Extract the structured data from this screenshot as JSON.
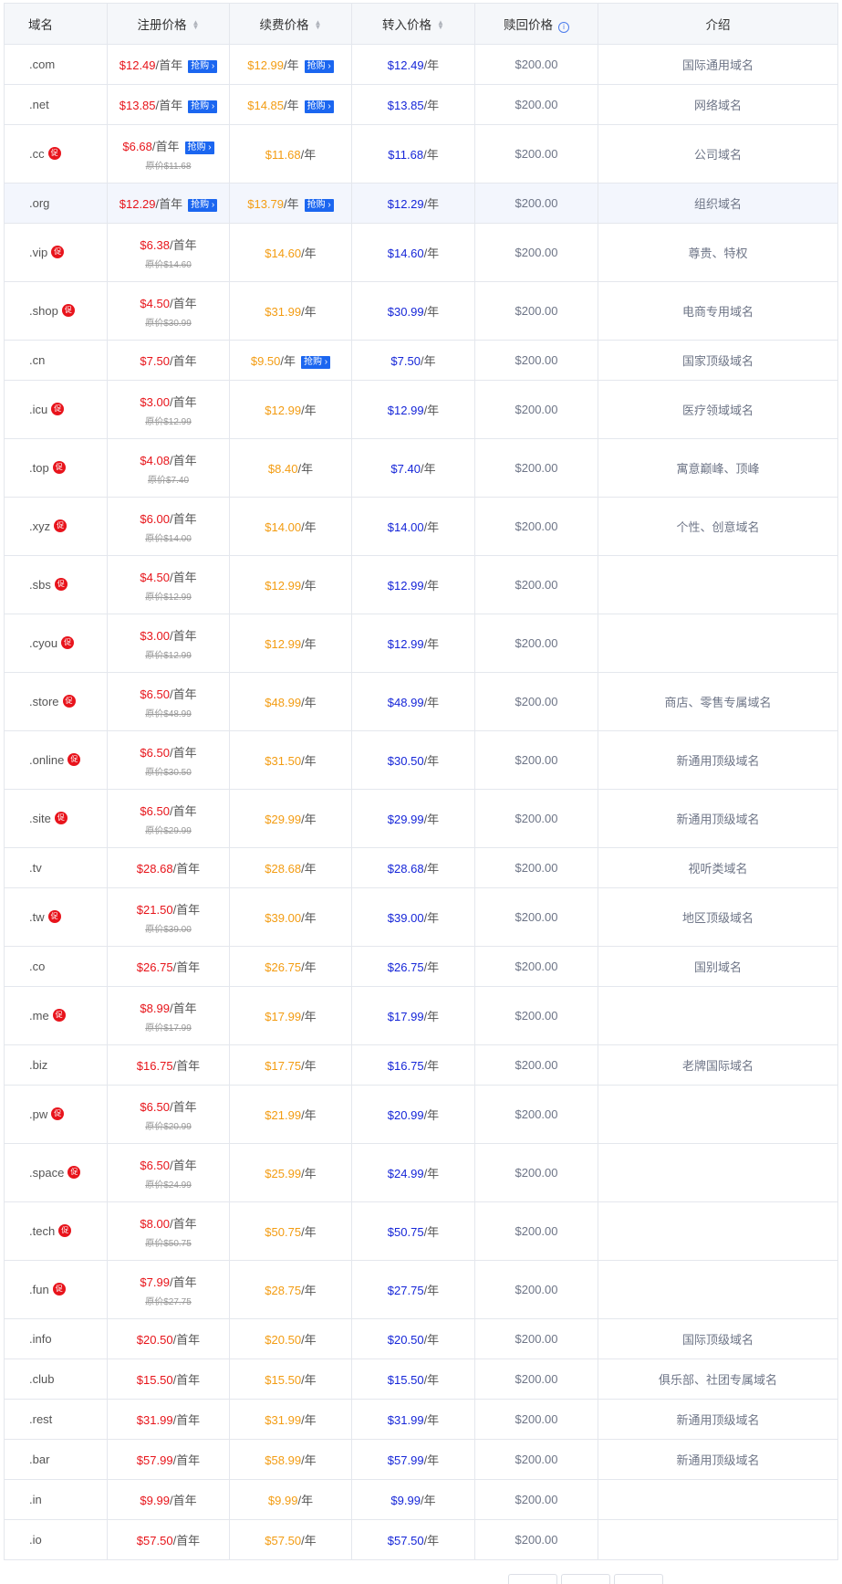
{
  "headers": {
    "domain": "域名",
    "register": "注册价格",
    "renew": "续费价格",
    "transfer": "转入价格",
    "redeem": "赎回价格",
    "intro": "介绍"
  },
  "labels": {
    "first_year": "/首年",
    "per_year": "/年",
    "rush_badge": "抢购",
    "promo_badge": "促"
  },
  "rows": [
    {
      "tld": ".com",
      "promo": false,
      "reg": "$12.49",
      "reg_unit": "/首年",
      "reg_badge": true,
      "orig": "",
      "renew": "$12.99",
      "renew_badge": true,
      "transfer": "$12.49",
      "redeem": "$200.00",
      "intro": "国际通用域名"
    },
    {
      "tld": ".net",
      "promo": false,
      "reg": "$13.85",
      "reg_unit": "/首年",
      "reg_badge": true,
      "orig": "",
      "renew": "$14.85",
      "renew_badge": true,
      "transfer": "$13.85",
      "redeem": "$200.00",
      "intro": "网络域名"
    },
    {
      "tld": ".cc",
      "promo": true,
      "reg": "$6.68",
      "reg_unit": "/首年",
      "reg_badge": true,
      "orig": "原价$11.68",
      "renew": "$11.68",
      "renew_badge": false,
      "transfer": "$11.68",
      "redeem": "$200.00",
      "intro": "公司域名"
    },
    {
      "tld": ".org",
      "promo": false,
      "reg": "$12.29",
      "reg_unit": "/首年",
      "reg_badge": true,
      "orig": "",
      "renew": "$13.79",
      "renew_badge": true,
      "transfer": "$12.29",
      "redeem": "$200.00",
      "intro": "组织域名",
      "highlight": true
    },
    {
      "tld": ".vip",
      "promo": true,
      "reg": "$6.38",
      "reg_unit": "/首年",
      "reg_badge": false,
      "orig": "原价$14.60",
      "renew": "$14.60",
      "renew_badge": false,
      "transfer": "$14.60",
      "redeem": "$200.00",
      "intro": "尊贵、特权"
    },
    {
      "tld": ".shop",
      "promo": true,
      "reg": "$4.50",
      "reg_unit": "/首年",
      "reg_badge": false,
      "orig": "原价$30.99",
      "renew": "$31.99",
      "renew_badge": false,
      "transfer": "$30.99",
      "redeem": "$200.00",
      "intro": "电商专用域名"
    },
    {
      "tld": ".cn",
      "promo": false,
      "reg": "$7.50",
      "reg_unit": "/首年",
      "reg_badge": false,
      "orig": "",
      "renew": "$9.50",
      "renew_badge": true,
      "transfer": "$7.50",
      "redeem": "$200.00",
      "intro": "国家顶级域名"
    },
    {
      "tld": ".icu",
      "promo": true,
      "reg": "$3.00",
      "reg_unit": "/首年",
      "reg_badge": false,
      "orig": "原价$12.99",
      "renew": "$12.99",
      "renew_badge": false,
      "transfer": "$12.99",
      "redeem": "$200.00",
      "intro": "医疗领域域名"
    },
    {
      "tld": ".top",
      "promo": true,
      "reg": "$4.08",
      "reg_unit": "/首年",
      "reg_badge": false,
      "orig": "原价$7.40",
      "renew": "$8.40",
      "renew_badge": false,
      "transfer": "$7.40",
      "redeem": "$200.00",
      "intro": "寓意巅峰、顶峰"
    },
    {
      "tld": ".xyz",
      "promo": true,
      "reg": "$6.00",
      "reg_unit": "/首年",
      "reg_badge": false,
      "orig": "原价$14.00",
      "renew": "$14.00",
      "renew_badge": false,
      "transfer": "$14.00",
      "redeem": "$200.00",
      "intro": "个性、创意域名"
    },
    {
      "tld": ".sbs",
      "promo": true,
      "reg": "$4.50",
      "reg_unit": "/首年",
      "reg_badge": false,
      "orig": "原价$12.99",
      "renew": "$12.99",
      "renew_badge": false,
      "transfer": "$12.99",
      "redeem": "$200.00",
      "intro": ""
    },
    {
      "tld": ".cyou",
      "promo": true,
      "reg": "$3.00",
      "reg_unit": "/首年",
      "reg_badge": false,
      "orig": "原价$12.99",
      "renew": "$12.99",
      "renew_badge": false,
      "transfer": "$12.99",
      "redeem": "$200.00",
      "intro": ""
    },
    {
      "tld": ".store",
      "promo": true,
      "reg": "$6.50",
      "reg_unit": "/首年",
      "reg_badge": false,
      "orig": "原价$48.99",
      "renew": "$48.99",
      "renew_badge": false,
      "transfer": "$48.99",
      "redeem": "$200.00",
      "intro": "商店、零售专属域名"
    },
    {
      "tld": ".online",
      "promo": true,
      "reg": "$6.50",
      "reg_unit": "/首年",
      "reg_badge": false,
      "orig": "原价$30.50",
      "renew": "$31.50",
      "renew_badge": false,
      "transfer": "$30.50",
      "redeem": "$200.00",
      "intro": "新通用顶级域名"
    },
    {
      "tld": ".site",
      "promo": true,
      "reg": "$6.50",
      "reg_unit": "/首年",
      "reg_badge": false,
      "orig": "原价$29.99",
      "renew": "$29.99",
      "renew_badge": false,
      "transfer": "$29.99",
      "redeem": "$200.00",
      "intro": "新通用顶级域名"
    },
    {
      "tld": ".tv",
      "promo": false,
      "reg": "$28.68",
      "reg_unit": "/首年",
      "reg_badge": false,
      "orig": "",
      "renew": "$28.68",
      "renew_badge": false,
      "transfer": "$28.68",
      "redeem": "$200.00",
      "intro": "视听类域名"
    },
    {
      "tld": ".tw",
      "promo": true,
      "reg": "$21.50",
      "reg_unit": "/首年",
      "reg_badge": false,
      "orig": "原价$39.00",
      "renew": "$39.00",
      "renew_badge": false,
      "transfer": "$39.00",
      "redeem": "$200.00",
      "intro": "地区顶级域名"
    },
    {
      "tld": ".co",
      "promo": false,
      "reg": "$26.75",
      "reg_unit": "/首年",
      "reg_badge": false,
      "orig": "",
      "renew": "$26.75",
      "renew_badge": false,
      "transfer": "$26.75",
      "redeem": "$200.00",
      "intro": "国别域名"
    },
    {
      "tld": ".me",
      "promo": true,
      "reg": "$8.99",
      "reg_unit": "/首年",
      "reg_badge": false,
      "orig": "原价$17.99",
      "renew": "$17.99",
      "renew_badge": false,
      "transfer": "$17.99",
      "redeem": "$200.00",
      "intro": ""
    },
    {
      "tld": ".biz",
      "promo": false,
      "reg": "$16.75",
      "reg_unit": "/首年",
      "reg_badge": false,
      "orig": "",
      "renew": "$17.75",
      "renew_badge": false,
      "transfer": "$16.75",
      "redeem": "$200.00",
      "intro": "老牌国际域名"
    },
    {
      "tld": ".pw",
      "promo": true,
      "reg": "$6.50",
      "reg_unit": "/首年",
      "reg_badge": false,
      "orig": "原价$20.99",
      "renew": "$21.99",
      "renew_badge": false,
      "transfer": "$20.99",
      "redeem": "$200.00",
      "intro": ""
    },
    {
      "tld": ".space",
      "promo": true,
      "reg": "$6.50",
      "reg_unit": "/首年",
      "reg_badge": false,
      "orig": "原价$24.99",
      "renew": "$25.99",
      "renew_badge": false,
      "transfer": "$24.99",
      "redeem": "$200.00",
      "intro": ""
    },
    {
      "tld": ".tech",
      "promo": true,
      "reg": "$8.00",
      "reg_unit": "/首年",
      "reg_badge": false,
      "orig": "原价$50.75",
      "renew": "$50.75",
      "renew_badge": false,
      "transfer": "$50.75",
      "redeem": "$200.00",
      "intro": ""
    },
    {
      "tld": ".fun",
      "promo": true,
      "reg": "$7.99",
      "reg_unit": "/首年",
      "reg_badge": false,
      "orig": "原价$27.75",
      "renew": "$28.75",
      "renew_badge": false,
      "transfer": "$27.75",
      "redeem": "$200.00",
      "intro": ""
    },
    {
      "tld": ".info",
      "promo": false,
      "reg": "$20.50",
      "reg_unit": "/首年",
      "reg_badge": false,
      "orig": "",
      "renew": "$20.50",
      "renew_badge": false,
      "transfer": "$20.50",
      "redeem": "$200.00",
      "intro": "国际顶级域名"
    },
    {
      "tld": ".club",
      "promo": false,
      "reg": "$15.50",
      "reg_unit": "/首年",
      "reg_badge": false,
      "orig": "",
      "renew": "$15.50",
      "renew_badge": false,
      "transfer": "$15.50",
      "redeem": "$200.00",
      "intro": "俱乐部、社团专属域名"
    },
    {
      "tld": ".rest",
      "promo": false,
      "reg": "$31.99",
      "reg_unit": "/首年",
      "reg_badge": false,
      "orig": "",
      "renew": "$31.99",
      "renew_badge": false,
      "transfer": "$31.99",
      "redeem": "$200.00",
      "intro": "新通用顶级域名"
    },
    {
      "tld": ".bar",
      "promo": false,
      "reg": "$57.99",
      "reg_unit": "/首年",
      "reg_badge": false,
      "orig": "",
      "renew": "$58.99",
      "renew_badge": false,
      "transfer": "$57.99",
      "redeem": "$200.00",
      "intro": "新通用顶级域名"
    },
    {
      "tld": ".in",
      "promo": false,
      "reg": "$9.99",
      "reg_unit": "/首年",
      "reg_badge": false,
      "orig": "",
      "renew": "$9.99",
      "renew_badge": false,
      "transfer": "$9.99",
      "redeem": "$200.00",
      "intro": ""
    },
    {
      "tld": ".io",
      "promo": false,
      "reg": "$57.50",
      "reg_unit": "/首年",
      "reg_badge": false,
      "orig": "",
      "renew": "$57.50",
      "renew_badge": false,
      "transfer": "$57.50",
      "redeem": "$200.00",
      "intro": ""
    }
  ],
  "colors": {
    "register_price": "#e7141a",
    "renew_price": "#f39c12",
    "transfer_price": "#1626d8",
    "badge_bg": "#1b66f0",
    "promo_bg": "#e8141c",
    "header_bg": "#f5f7fa",
    "highlight_bg": "#f3f6fd"
  },
  "icons": {
    "sort": "sort-caret-icon",
    "info": "info-circle-icon",
    "promo": "promo-icon",
    "rush_arrow": "chevron-right-icon"
  }
}
